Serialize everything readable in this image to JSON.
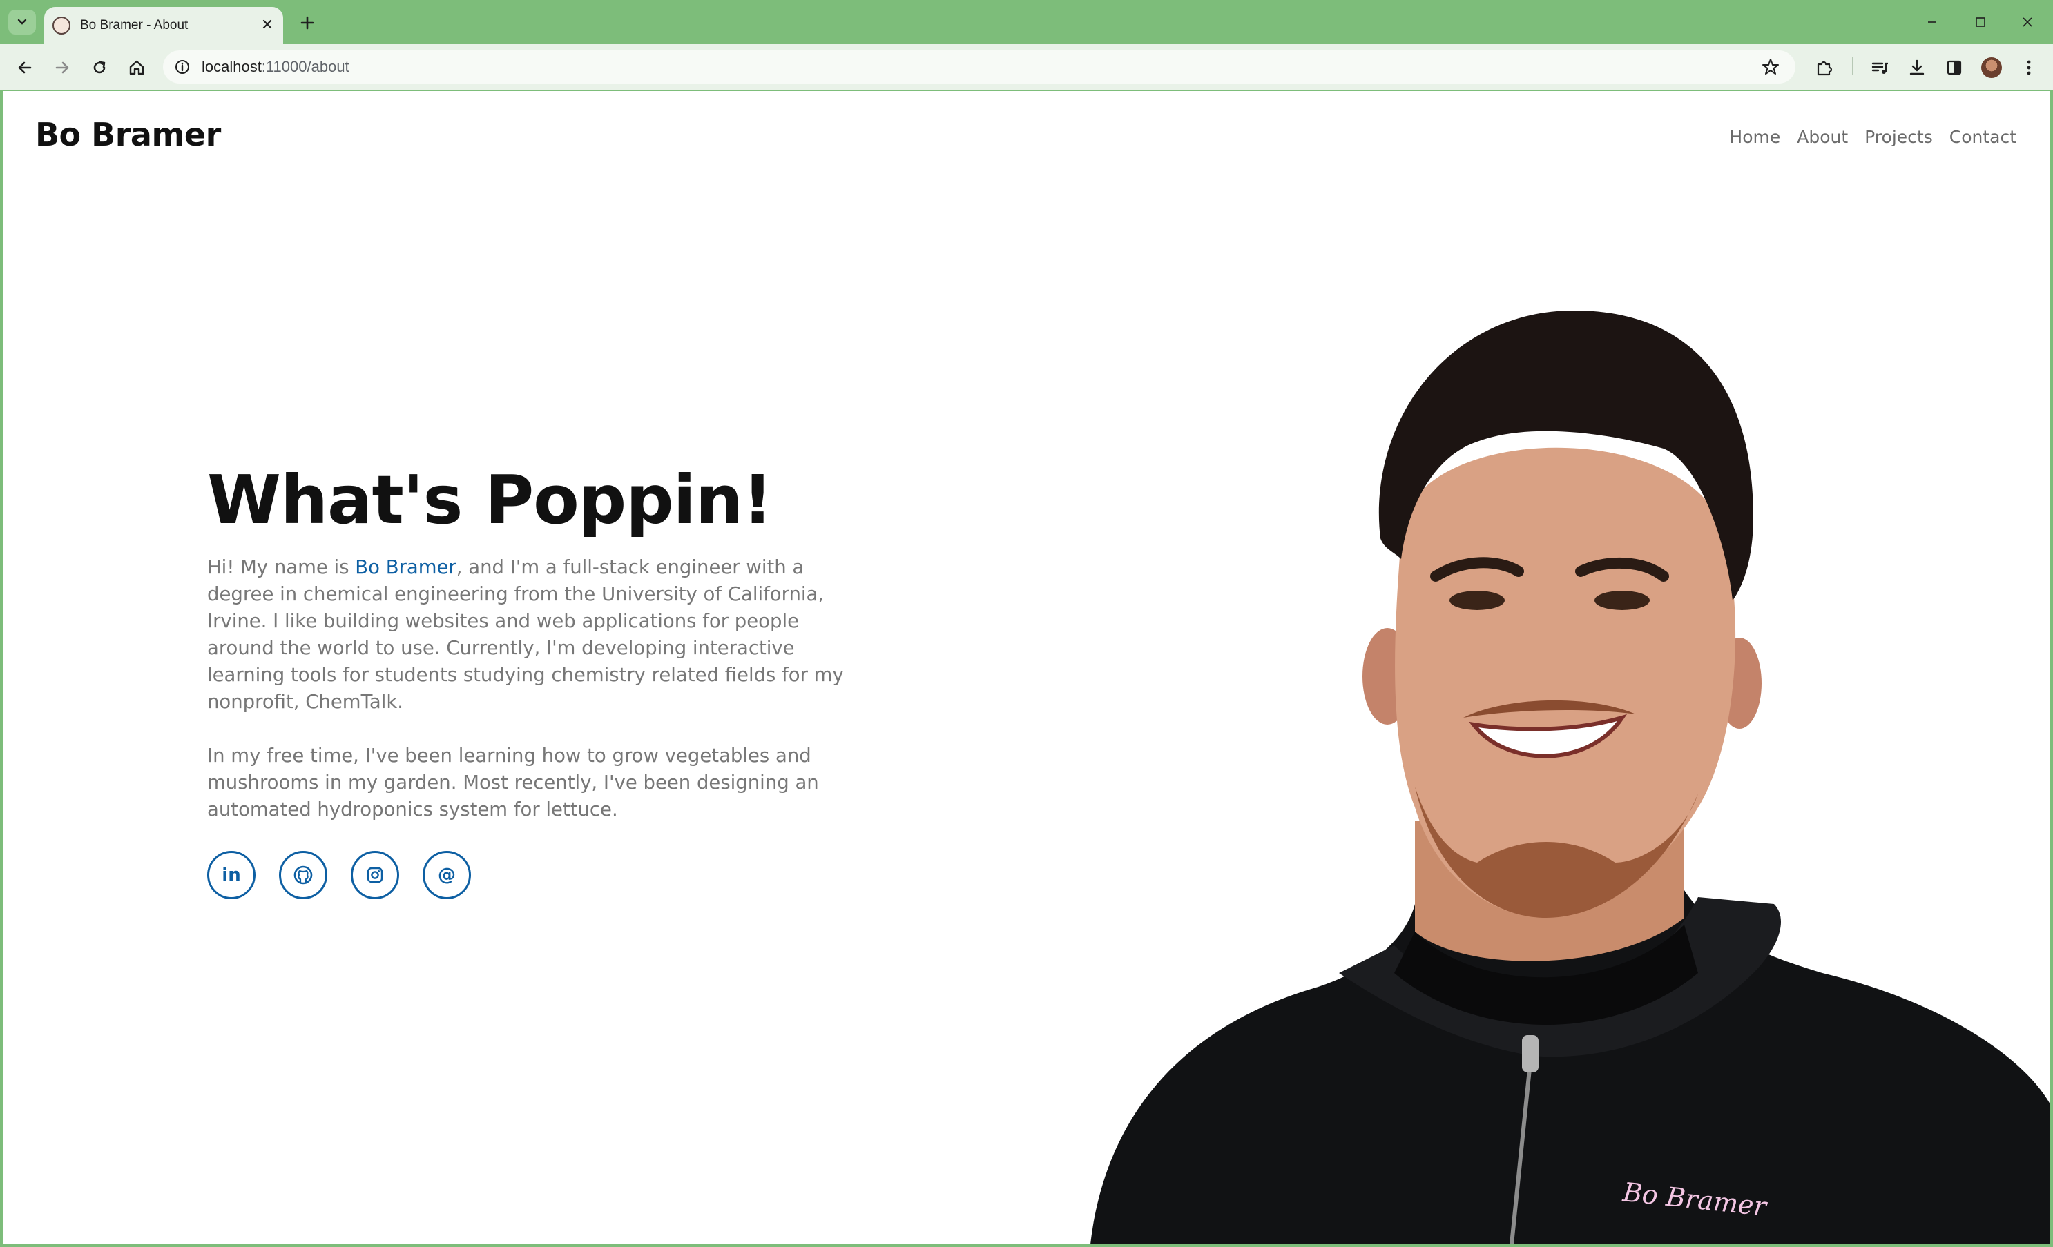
{
  "browser": {
    "tab": {
      "title": "Bo Bramer - About"
    },
    "address": {
      "host": "localhost",
      "rest": ":11000/about"
    }
  },
  "site": {
    "logo": "Bo Bramer",
    "nav": [
      "Home",
      "About",
      "Projects",
      "Contact"
    ]
  },
  "hero": {
    "headline": "What's Poppin!",
    "para1_before": "Hi! My name is ",
    "para1_link": "Bo Bramer",
    "para1_after": ", and I'm a full-stack engineer with a degree in chemical engineering from the University of California, Irvine. I like building websites and web applications for people around the world to use. Currently, I'm developing interactive learning tools for students studying chemistry related fields for my nonprofit, ChemTalk.",
    "para2": "In my free time, I've been learning how to grow vegetables and mushrooms in my garden. Most recently, I've been designing an automated hydroponics system for lettuce.",
    "socials": [
      {
        "name": "linkedin",
        "glyph": "in"
      },
      {
        "name": "github",
        "glyph": ""
      },
      {
        "name": "instagram",
        "glyph": ""
      },
      {
        "name": "email",
        "glyph": "@"
      }
    ]
  },
  "portrait": {
    "shirt_text": "Bo Bramer"
  },
  "colors": {
    "chrome_frame": "#7dbd7a",
    "chrome_toolbar": "#e9f2e8",
    "accent_link": "#0d5fa3",
    "body_text": "#777777",
    "heading": "#111111"
  }
}
